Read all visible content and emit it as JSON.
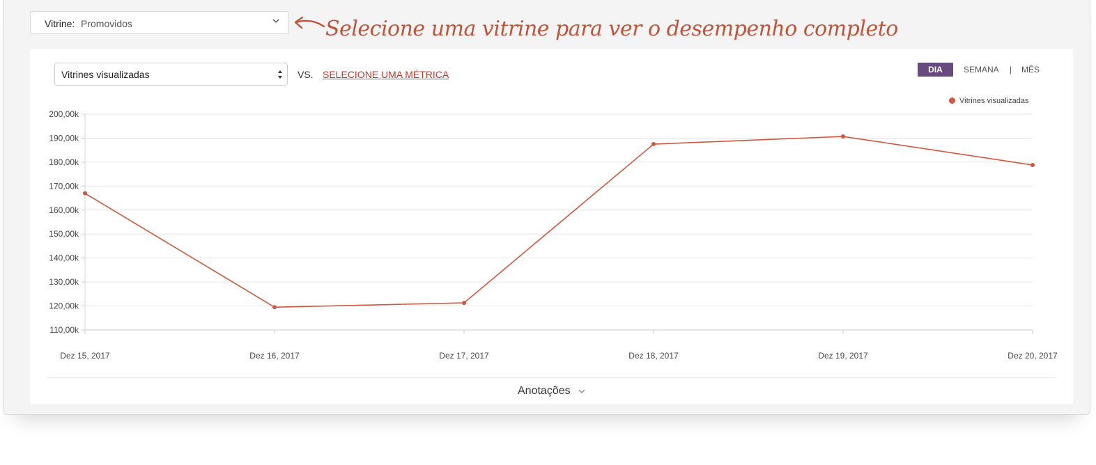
{
  "header": {
    "vitrine_label": "Vitrine:",
    "vitrine_value": "Promovidos",
    "annotation": "Selecione uma vitrine para ver o desempenho completo"
  },
  "controls": {
    "metric_selected": "Vitrines visualizadas",
    "vs_label": "VS.",
    "select_metric_link": "SELECIONE UMA MÉTRICA",
    "periods": {
      "day": "DIA",
      "week": "SEMANA",
      "separator": "|",
      "month": "MÊS"
    },
    "active_period": "DIA"
  },
  "colors": {
    "series": "#d0573f",
    "accent": "#674b7f",
    "annotation": "#c0543a"
  },
  "chart_data": {
    "type": "line",
    "x": [
      "Dez 15, 2017",
      "Dez 16, 2017",
      "Dez 17, 2017",
      "Dez 18, 2017",
      "Dez 19, 2017",
      "Dez 20, 2017"
    ],
    "series": [
      {
        "name": "Vitrines visualizadas",
        "values": [
          167000,
          119500,
          121300,
          187500,
          190700,
          178800
        ]
      }
    ],
    "y_ticks": [
      110000,
      120000,
      130000,
      140000,
      150000,
      160000,
      170000,
      180000,
      190000,
      200000
    ],
    "y_tick_labels": [
      "110,00k",
      "120,00k",
      "130,00k",
      "140,00k",
      "150,00k",
      "160,00k",
      "170,00k",
      "180,00k",
      "190,00k",
      "200,00k"
    ],
    "ylim": [
      110000,
      200000
    ],
    "grid": true,
    "legend_position": "top-right"
  },
  "footer": {
    "notes_label": "Anotações"
  }
}
